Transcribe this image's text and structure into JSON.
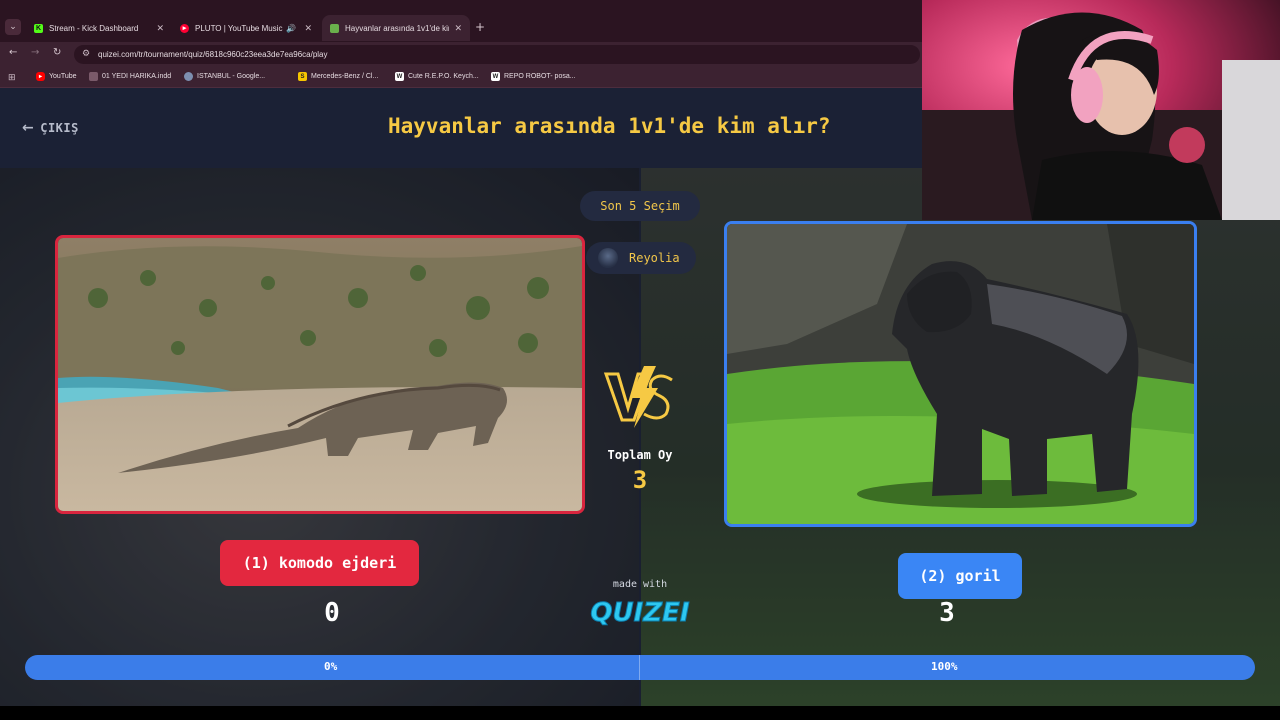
{
  "browser": {
    "tabs": [
      {
        "title": "Stream - Kick Dashboard",
        "favicon": "kick-icon",
        "active": false
      },
      {
        "title": "PLUTO | YouTube Music",
        "favicon": "youtube-music-icon",
        "active": false
      },
      {
        "title": "Hayvanlar arasında 1v1'de kim",
        "favicon": "quizei-icon",
        "active": true
      }
    ],
    "url": "quizei.com/tr/tournament/quiz/6818c960c23eea3de7ea96ca/play",
    "bookmarks": [
      {
        "label": "YouTube",
        "icon": "youtube-icon"
      },
      {
        "label": "01 YEDI HARIKA.indd",
        "icon": "file-icon"
      },
      {
        "label": "ISTANBUL - Google...",
        "icon": "globe-icon"
      },
      {
        "label": "Mercedes-Benz / Cl...",
        "icon": "s-icon"
      },
      {
        "label": "Cute R.E.P.O. Keych...",
        "icon": "keychain-icon"
      },
      {
        "label": "REPO ROBOT- posa...",
        "icon": "keychain-icon"
      }
    ]
  },
  "quiz": {
    "exit_label": "ÇIKIŞ",
    "title": "Hayvanlar arasında 1v1'de kim alır?",
    "recent_label": "Son 5 Seçim",
    "recent_user": "Reyolia",
    "total_label": "Toplam Oy",
    "total_value": "3",
    "made_with": "made with",
    "brand": "QUIZEI",
    "left": {
      "label": "(1) komodo ejderi",
      "votes": "0",
      "percent_label": "0%",
      "percent": 0,
      "color": "#e3283f"
    },
    "right": {
      "label": "(2) goril",
      "votes": "3",
      "percent_label": "100%",
      "percent": 100,
      "color": "#3a86f5"
    },
    "accent": "#f6c944"
  }
}
